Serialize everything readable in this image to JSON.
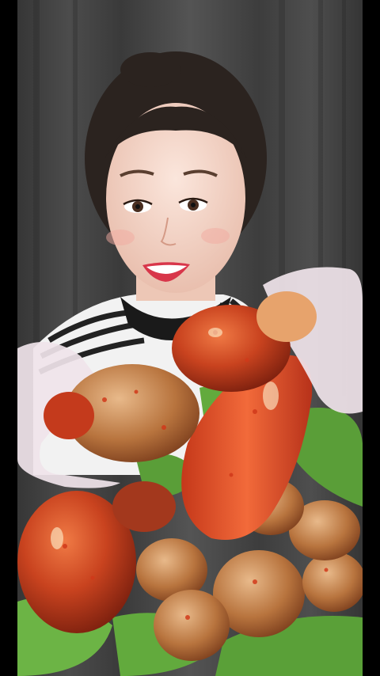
{
  "scene": {
    "description_tag": "mukbang-video-frame",
    "colors": {
      "background_curtain": "#4a4a4a",
      "sauce": "#c0391b",
      "lettuce": "#5fa63a",
      "skin": "#f3d3c4",
      "hair": "#2b231f",
      "gloves": "#f0e4ea"
    }
  }
}
